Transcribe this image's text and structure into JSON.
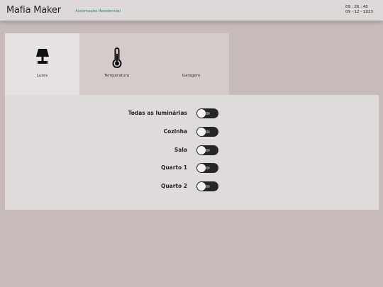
{
  "header": {
    "brand": "Mafia Maker",
    "subtitle": "Automação Residencial",
    "time": "09 : 26 : 40",
    "date": "09 - 12 - 2023"
  },
  "tabs": [
    {
      "label": "Luzes",
      "icon": "lamp-icon",
      "active": true
    },
    {
      "label": "Temperatura",
      "icon": "thermometer-icon",
      "active": false
    },
    {
      "label": "Garagem",
      "icon": "",
      "active": false
    }
  ],
  "lights": [
    {
      "label": "Todas as luminárias",
      "on": false
    },
    {
      "label": "Cozinha",
      "on": false
    },
    {
      "label": "Sala",
      "on": false
    },
    {
      "label": "Quarto 1",
      "on": false
    },
    {
      "label": "Quarto 2",
      "on": false
    }
  ],
  "colors": {
    "background": "#c7baba",
    "header": "#dfd8d8",
    "accent": "#1a8a74",
    "toggle": "#262626"
  }
}
